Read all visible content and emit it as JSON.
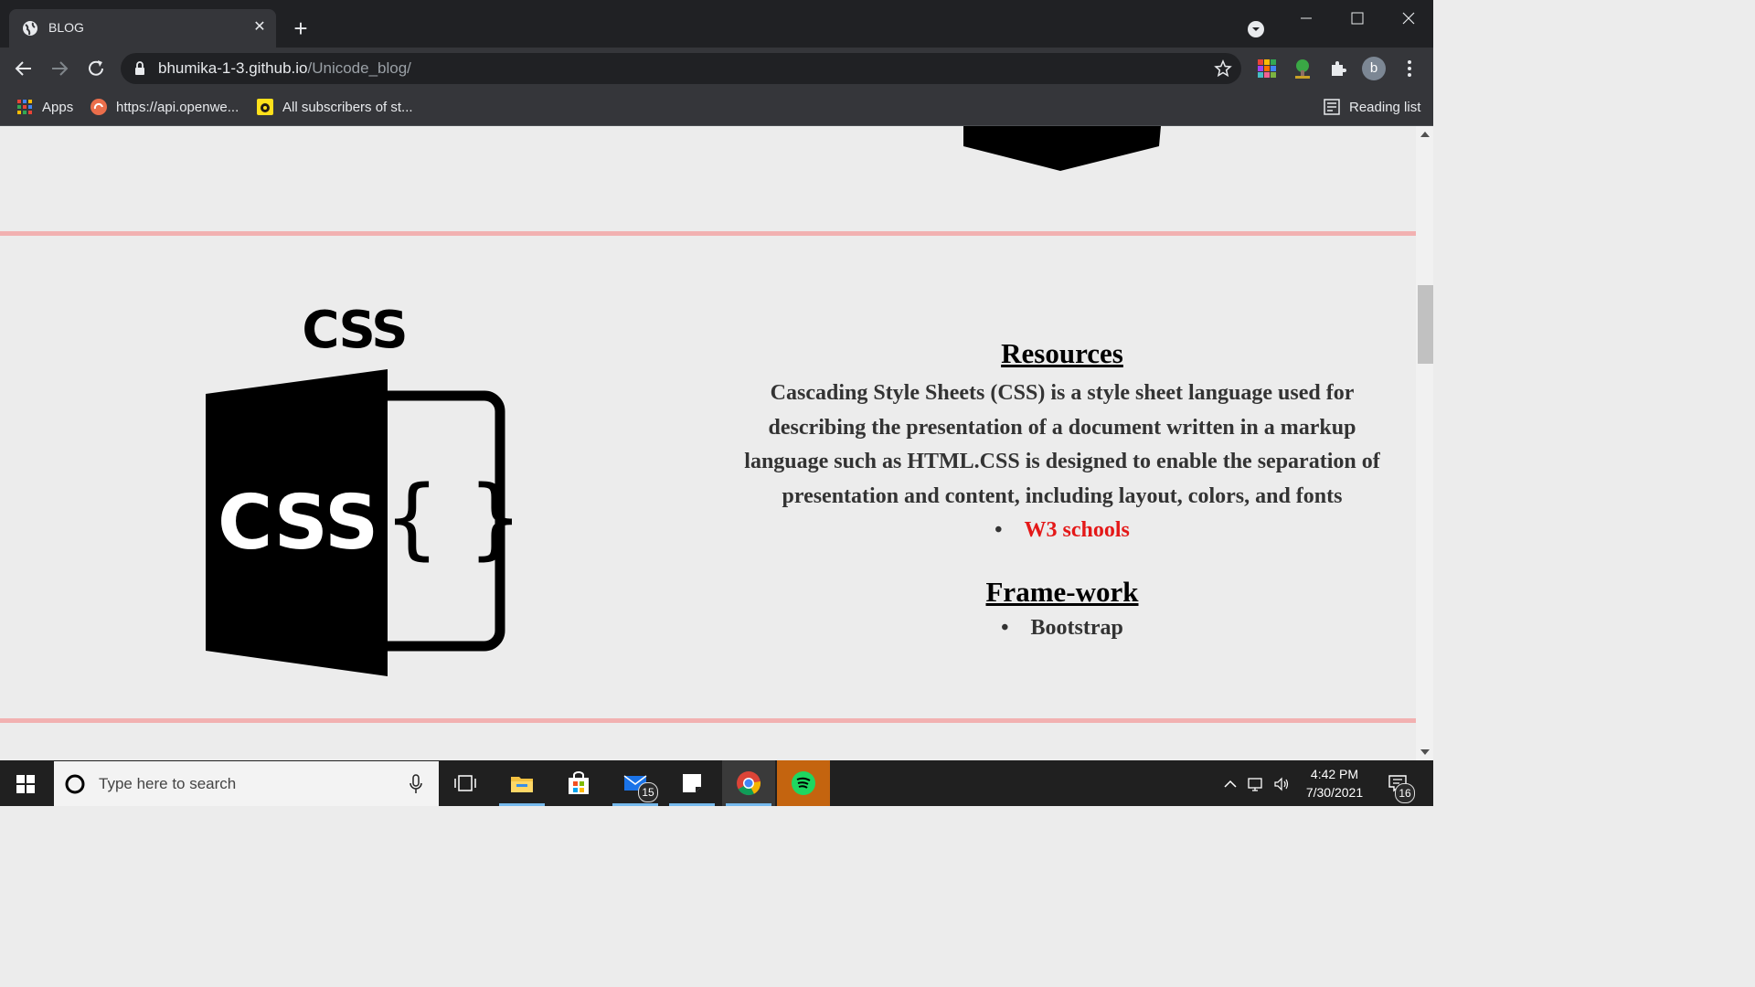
{
  "browser": {
    "tab_title": "BLOG",
    "url_host": "bhumika-1-3.github.io",
    "url_path": "/Unicode_blog/",
    "avatar_letter": "b",
    "bookmarks": [
      {
        "label": "Apps",
        "icon": "apps-grid-icon"
      },
      {
        "label": "https://api.openwe...",
        "icon": "openweather-icon"
      },
      {
        "label": "All subscribers of st...",
        "icon": "mailchimp-icon"
      }
    ],
    "reading_list": "Reading list"
  },
  "page": {
    "css_logo_title": "CSS",
    "css_icon_text": "CSS",
    "css_icon_braces": "{ }",
    "resources_title": "Resources",
    "description": "Cascading Style Sheets (CSS) is a style sheet language used for describing the presentation of a document written in a markup language such as HTML.CSS is designed to enable the separation of presentation and content, including layout, colors, and fonts",
    "resource_link": "W3 schools",
    "framework_title": "Frame-work",
    "framework_item": "Bootstrap",
    "colors": {
      "divider": "#f2b1b1",
      "link": "#e41818",
      "background": "#ececec"
    }
  },
  "taskbar": {
    "search_placeholder": "Type here to search",
    "mail_badge": "15",
    "time": "4:42 PM",
    "date": "7/30/2021",
    "notification_count": "16"
  }
}
